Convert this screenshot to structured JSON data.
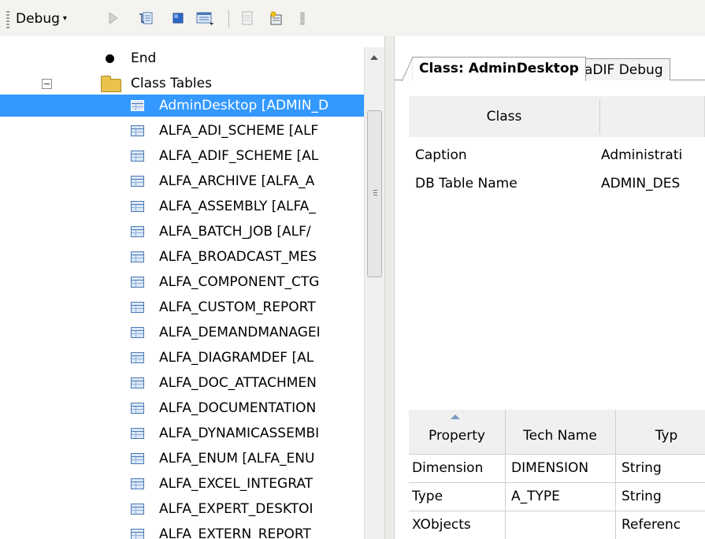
{
  "toolbar": {
    "debug_label": "Debug",
    "caret": "▾",
    "icons": [
      "play-icon",
      "step-into-icon",
      "stop-icon",
      "window-icon",
      "document-icon",
      "new-item-icon",
      "exclamation-icon"
    ]
  },
  "tree": {
    "end_label": "End",
    "folder_label": "Class Tables",
    "items": [
      "AdminDesktop  [ADMIN_D",
      "ALFA_ADI_SCHEME  [ALF",
      "ALFA_ADIF_SCHEME  [AL",
      "ALFA_ARCHIVE  [ALFA_A",
      "ALFA_ASSEMBLY  [ALFA_",
      "ALFA_BATCH_JOB  [ALF/",
      "ALFA_BROADCAST_MES",
      "ALFA_COMPONENT_CTG",
      "ALFA_CUSTOM_REPORT",
      "ALFA_DEMANDMANAGEI",
      "ALFA_DIAGRAMDEF  [AL",
      "ALFA_DOC_ATTACHMEN",
      "ALFA_DOCUMENTATION",
      "ALFA_DYNAMICASSEMBI",
      "ALFA_ENUM  [ALFA_ENU",
      "ALFA_EXCEL_INTEGRAT",
      "ALFA_EXPERT_DESKTOI",
      "ALFA_EXTERN_REPORT"
    ],
    "selected_index": 0
  },
  "tabs": {
    "active": "Class: AdminDesktop",
    "inactive": "aDIF Debug"
  },
  "class_panel": {
    "header_col1": "Class",
    "rows": [
      {
        "label": "Caption",
        "value": "Administrati"
      },
      {
        "label": "DB Table Name",
        "value": "ADMIN_DES"
      }
    ]
  },
  "grid": {
    "headers": [
      "Property",
      "Tech Name",
      "Typ"
    ],
    "rows": [
      [
        "Dimension",
        "DIMENSION",
        "String"
      ],
      [
        "Type",
        "A_TYPE",
        "String"
      ],
      [
        "XObjects",
        "",
        "Referenc"
      ]
    ]
  },
  "colors": {
    "selection": "#3399ff",
    "toolbar_bg": "#f4f3f0",
    "header_bg": "#f0f0f0"
  }
}
